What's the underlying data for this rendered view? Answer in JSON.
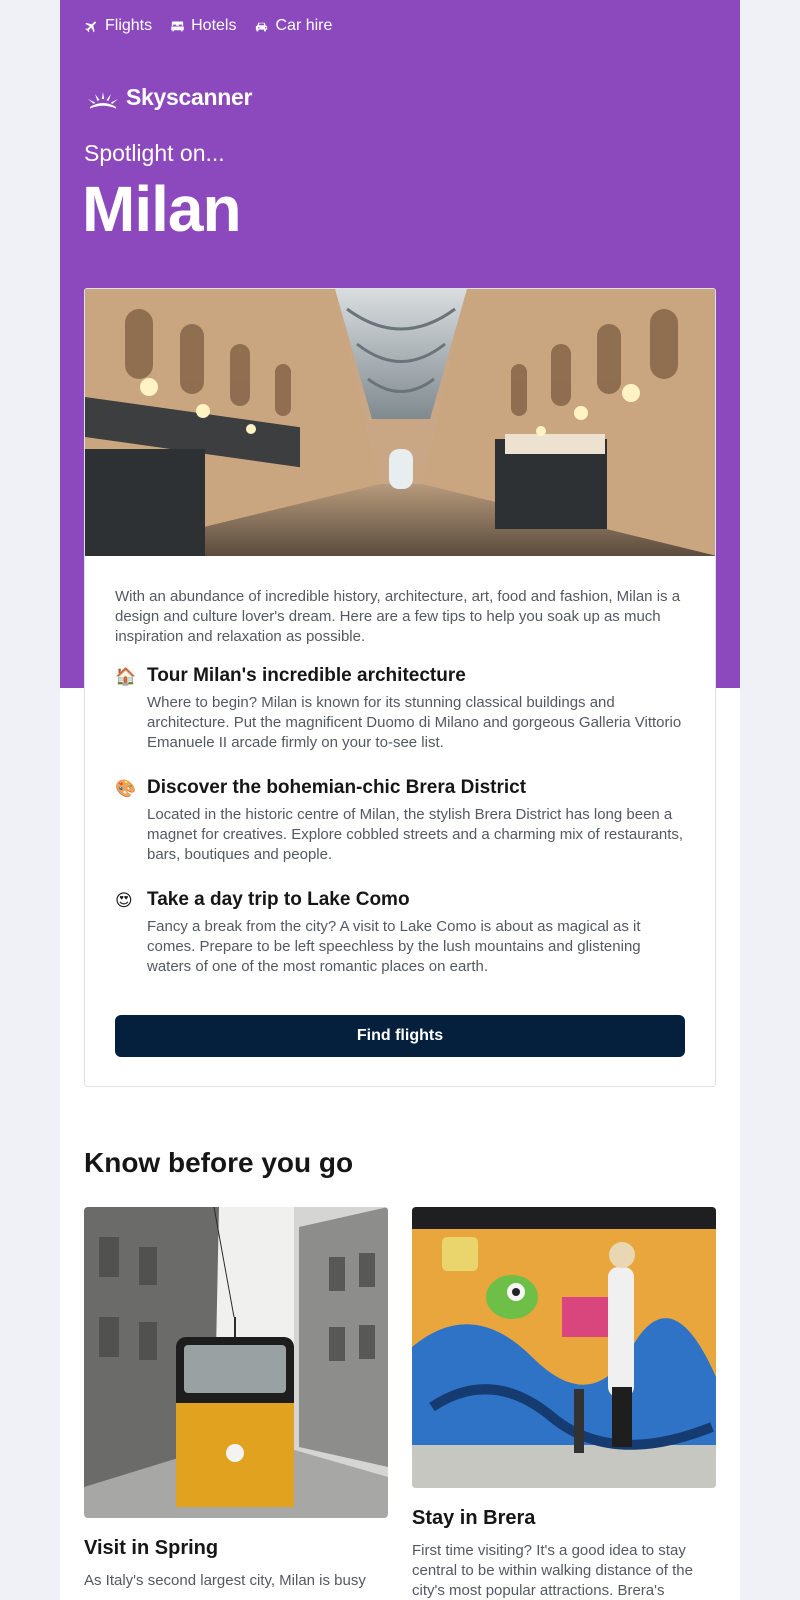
{
  "nav": {
    "flights": "Flights",
    "hotels": "Hotels",
    "car_hire": "Car hire"
  },
  "brand": {
    "name": "Skyscanner"
  },
  "hero": {
    "kicker": "Spotlight on...",
    "city": "Milan"
  },
  "intro": "With an abundance of incredible history, architecture, art, food and fashion, Milan is a design and culture lover's dream. Here are a few tips to help you soak up as much inspiration and relaxation as possible.",
  "tips": [
    {
      "icon": "house-icon",
      "emoji": "🏠",
      "title": "Tour Milan's incredible architecture",
      "body": "Where to begin? Milan is known for its stunning classical buildings and architecture. Put the magnificent Duomo di Milano and gorgeous Galleria Vittorio Emanuele II arcade firmly on your to-see list."
    },
    {
      "icon": "palette-icon",
      "emoji": "🎨",
      "title": "Discover the bohemian-chic Brera District",
      "body": "Located in the historic centre of Milan, the stylish Brera District has long been a magnet for creatives. Explore cobbled streets and a charming mix of restaurants, bars, boutiques and people."
    },
    {
      "icon": "heart-eyes-icon",
      "emoji": "😍",
      "title": "Take a day trip to Lake Como",
      "body": "Fancy a break from the city? A visit to Lake Como is about as magical as it comes. Prepare to be left speechless by the lush mountains and glistening waters of one of the most romantic places on earth."
    }
  ],
  "cta": {
    "label": "Find flights"
  },
  "know_before": {
    "heading": "Know before you go",
    "tiles": [
      {
        "title": "Visit in Spring",
        "body": "As Italy's second largest city, Milan is busy"
      },
      {
        "title": "Stay in Brera",
        "body": "First time visiting? It's a good idea to stay central to be within walking distance of the city's most popular attractions. Brera's"
      }
    ]
  },
  "colors": {
    "hero_purple": "#8c49bd",
    "cta_navy": "#05203c",
    "page_bg": "#eff1f6"
  }
}
